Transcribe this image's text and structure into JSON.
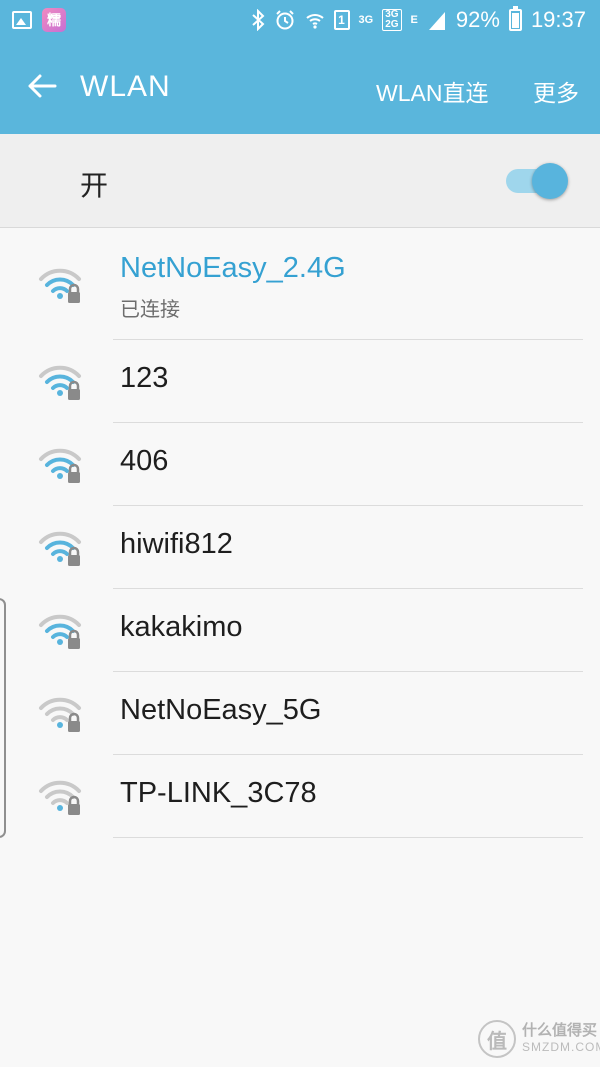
{
  "status_bar": {
    "app_icon_char": "糯",
    "net_3g": "3G",
    "net_stack_top": "3G",
    "net_stack_bottom": "2G",
    "net_e": "E",
    "sim_slot": "1",
    "battery": "92%",
    "time": "19:37"
  },
  "app_bar": {
    "back_icon": "arrow-left-icon",
    "title": "WLAN",
    "wlan_direct_label": "WLAN直连",
    "more_label": "更多"
  },
  "wlan_switch": {
    "label": "开",
    "is_on": true
  },
  "networks": [
    {
      "ssid": "NetNoEasy_2.4G",
      "status": "已连接",
      "connected": true,
      "signal_level": 3,
      "secured": true
    },
    {
      "ssid": "123",
      "status": "",
      "connected": false,
      "signal_level": 3,
      "secured": true
    },
    {
      "ssid": "406",
      "status": "",
      "connected": false,
      "signal_level": 3,
      "secured": true
    },
    {
      "ssid": "hiwifi812",
      "status": "",
      "connected": false,
      "signal_level": 3,
      "secured": true
    },
    {
      "ssid": "kakakimo",
      "status": "",
      "connected": false,
      "signal_level": 3,
      "secured": true
    },
    {
      "ssid": "NetNoEasy_5G",
      "status": "",
      "connected": false,
      "signal_level": 1,
      "secured": true
    },
    {
      "ssid": "TP-LINK_3C78",
      "status": "",
      "connected": false,
      "signal_level": 1,
      "secured": true
    }
  ],
  "watermark": {
    "logo_char": "值",
    "line1": "什么值得买",
    "line2": "SMZDM.COM"
  },
  "colors": {
    "accent": "#5ab6dc",
    "connected_text": "#35a1d2",
    "signal_active": "#58b4dd",
    "signal_inactive": "#c9c9c9",
    "lock": "#8a8a8a"
  }
}
